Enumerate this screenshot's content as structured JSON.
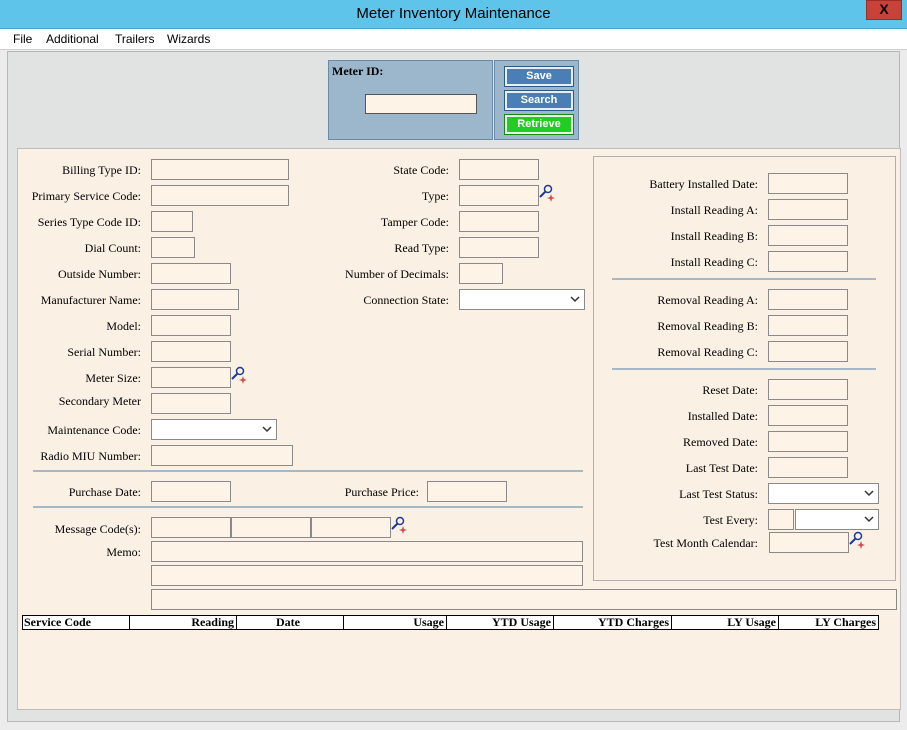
{
  "window": {
    "title": "Meter Inventory Maintenance",
    "close_label": "X"
  },
  "menu": [
    "File",
    "Additional",
    "Trailers",
    "Wizards"
  ],
  "meter_id": {
    "label": "Meter ID:",
    "value": ""
  },
  "buttons": {
    "save": "Save",
    "search": "Search",
    "retrieve": "Retrieve"
  },
  "left_fields": {
    "billing_type_id": "Billing Type ID:",
    "primary_service_code": "Primary Service Code:",
    "series_type_code_id": "Series Type Code ID:",
    "dial_count": "Dial Count:",
    "outside_number": "Outside Number:",
    "manufacturer_name": "Manufacturer Name:",
    "model": "Model:",
    "serial_number": "Serial Number:",
    "meter_size": "Meter Size:",
    "secondary_meter": "Secondary Meter",
    "maintenance_code": "Maintenance Code:",
    "radio_miu_number": "Radio MIU Number:"
  },
  "middle_fields": {
    "state_code": "State Code:",
    "type": "Type:",
    "tamper_code": "Tamper Code:",
    "read_type": "Read Type:",
    "number_of_decimals": "Number of Decimals:",
    "connection_state": "Connection State:"
  },
  "purchase": {
    "date": "Purchase Date:",
    "price": "Purchase Price:"
  },
  "message_codes": "Message Code(s):",
  "memo": "Memo:",
  "right_fields": {
    "battery_installed_date": "Battery Installed Date:",
    "install_reading_a": "Install Reading A:",
    "install_reading_b": "Install Reading B:",
    "install_reading_c": "Install Reading C:",
    "removal_reading_a": "Removal Reading A:",
    "removal_reading_b": "Removal Reading B:",
    "removal_reading_c": "Removal Reading C:",
    "reset_date": "Reset Date:",
    "installed_date": "Installed Date:",
    "removed_date": "Removed Date:",
    "last_test_date": "Last Test Date:",
    "last_test_status": "Last Test Status:",
    "test_every": "Test Every:",
    "test_month_calendar": "Test Month Calendar:"
  },
  "grid_columns": [
    "Service Code",
    "Reading",
    "Date",
    "Usage",
    "YTD Usage",
    "YTD Charges",
    "LY Usage",
    "LY Charges"
  ],
  "icons": {
    "lookup": "search-sparkle-icon",
    "dropdown": "chevron-down-icon"
  },
  "colors": {
    "titlebar": "#5fc4ea",
    "close": "#c9423a",
    "panel": "#fbf0e4",
    "meter_box": "#9cb6cc",
    "button_blue": "#4a7fb5",
    "button_green": "#22cc22"
  }
}
